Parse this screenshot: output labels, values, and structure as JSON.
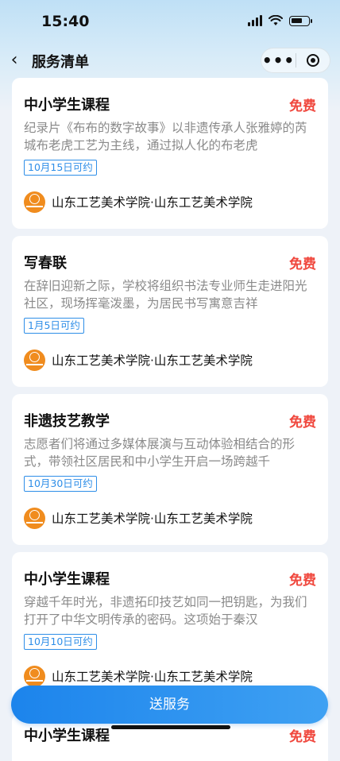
{
  "status_bar": {
    "time": "15:40"
  },
  "nav": {
    "back_icon": "‹",
    "title": "服务清单",
    "more_label": "•••"
  },
  "cards": [
    {
      "title": "中小学生课程",
      "price": "免费",
      "description": "纪录片《布布的数字故事》以非遗传承人张雅婷的芮城布老虎工艺为主线，通过拟人化的布老虎",
      "date_tag": "10月15日可约",
      "org": "山东工艺美术学院·山东工艺美术学院"
    },
    {
      "title": "写春联",
      "price": "免费",
      "description": "在辞旧迎新之际，学校将组织书法专业师生走进阳光社区，现场挥毫泼墨，为居民书写寓意吉祥",
      "date_tag": "1月5日可约",
      "org": "山东工艺美术学院·山东工艺美术学院"
    },
    {
      "title": "非遗技艺教学",
      "price": "免费",
      "description": "志愿者们将通过多媒体展演与互动体验相结合的形式，带领社区居民和中小学生开启一场跨越千",
      "date_tag": "10月30日可约",
      "org": "山东工艺美术学院·山东工艺美术学院"
    },
    {
      "title": "中小学生课程",
      "price": "免费",
      "description": "穿越千年时光，非遗拓印技艺如同一把钥匙，为我们打开了中华文明传承的密码。这项始于秦汉",
      "date_tag": "10月10日可约",
      "org": "山东工艺美术学院·山东工艺美术学院"
    },
    {
      "title": "中小学生课程",
      "price": "免费"
    }
  ],
  "cta": {
    "label": "送服务"
  },
  "colors": {
    "accent": "#2e8ee8",
    "price": "#f0483e",
    "cta_start": "#1c84ec",
    "cta_end": "#3fa1f3"
  }
}
